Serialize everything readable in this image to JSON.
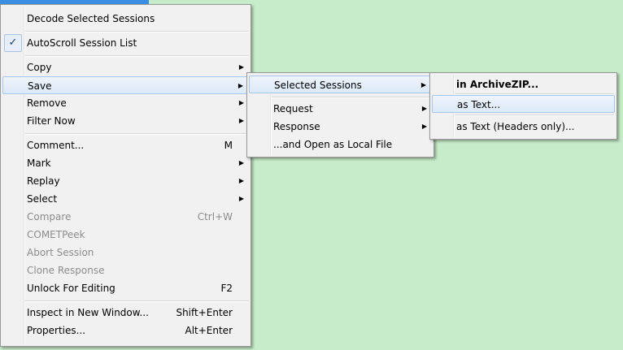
{
  "main_menu": {
    "items": [
      {
        "label": "Decode Selected Sessions"
      },
      {
        "label": "AutoScroll Session List",
        "checked_icon": "✓"
      },
      {
        "label": "Copy",
        "arrow": "▶"
      },
      {
        "label": "Save",
        "arrow": "▶"
      },
      {
        "label": "Remove",
        "arrow": "▶"
      },
      {
        "label": "Filter Now",
        "arrow": "▶"
      },
      {
        "label": "Comment...",
        "shortcut": "M"
      },
      {
        "label": "Mark",
        "arrow": "▶"
      },
      {
        "label": "Replay",
        "arrow": "▶"
      },
      {
        "label": "Select",
        "arrow": "▶"
      },
      {
        "label": "Compare",
        "shortcut": "Ctrl+W"
      },
      {
        "label": "COMETPeek"
      },
      {
        "label": "Abort Session"
      },
      {
        "label": "Clone Response"
      },
      {
        "label": "Unlock For Editing",
        "shortcut": "F2"
      },
      {
        "label": "Inspect in New Window...",
        "shortcut": "Shift+Enter"
      },
      {
        "label": "Properties...",
        "shortcut": "Alt+Enter"
      }
    ]
  },
  "save_submenu": {
    "items": [
      {
        "label": "Selected Sessions",
        "arrow": "▶"
      },
      {
        "label": "Request",
        "arrow": "▶"
      },
      {
        "label": "Response",
        "arrow": "▶"
      },
      {
        "label": "...and Open as Local File"
      }
    ]
  },
  "selected_sessions_submenu": {
    "items": [
      {
        "label": "in ArchiveZIP..."
      },
      {
        "label": "as Text..."
      },
      {
        "label": "as Text (Headers only)..."
      }
    ]
  },
  "colors": {
    "background": "#c7ecc9",
    "menu_bg": "#f1f1f1",
    "highlight_border": "#a8c6ec",
    "disabled_text": "#8c8c8c"
  }
}
